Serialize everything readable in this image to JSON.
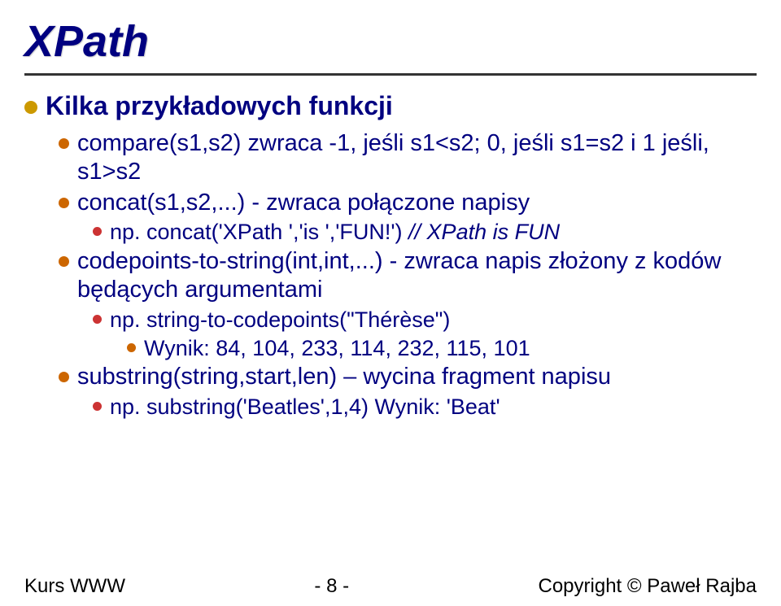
{
  "title": "XPath",
  "lines": {
    "l1": "Kilka przykładowych funkcji",
    "l2": "compare(s1,s2) zwraca -1, jeśli s1<s2; 0, jeśli s1=s2 i 1 jeśli, s1>s2",
    "l3": "concat(s1,s2,...) - zwraca połączone napisy",
    "l4a": "np. concat('XPath ','is ','FUN!') ",
    "l4b": "// XPath is FUN",
    "l5": "codepoints-to-string(int,int,...) - zwraca napis złożony z kodów będących argumentami",
    "l6": "np. string-to-codepoints(\"Thérèse\")",
    "l7": "Wynik: 84, 104, 233, 114, 232, 115, 101",
    "l8": "substring(string,start,len) – wycina fragment napisu",
    "l9": "np. substring('Beatles',1,4) Wynik: 'Beat'"
  },
  "footer": {
    "left": "Kurs WWW",
    "center": "- 8 -",
    "right": "Copyright © Paweł Rajba"
  }
}
